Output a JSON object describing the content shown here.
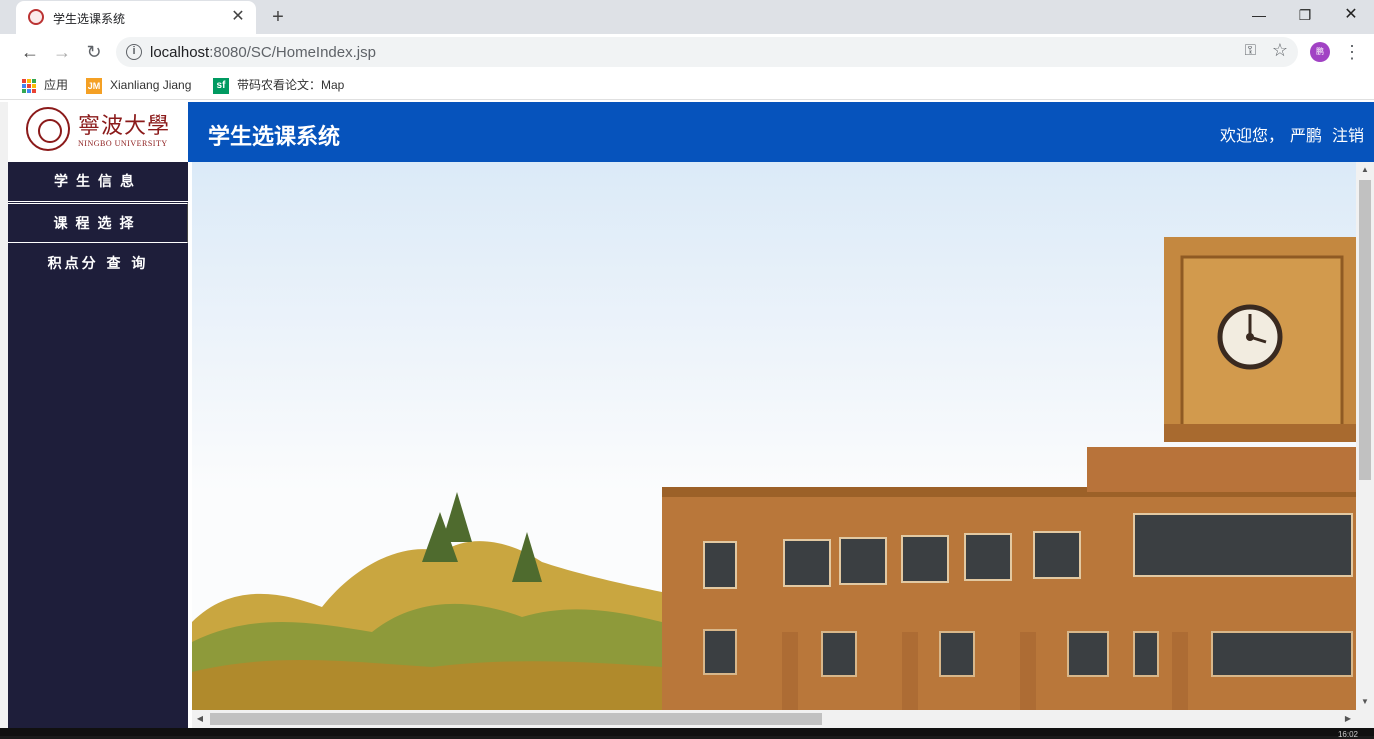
{
  "browser": {
    "tab_title": "学生选课系统",
    "tab_close": "✕",
    "new_tab": "+",
    "window_controls": {
      "minimize": "—",
      "maximize": "❐",
      "close": "✕"
    },
    "url_host": "localhost",
    "url_rest": ":8080/SC/HomeIndex.jsp",
    "profile_initial": "鹏",
    "bookmarks": [
      {
        "label": "应用",
        "icon": "apps-grid-icon"
      },
      {
        "label": "Xianliang Jiang",
        "icon": "jm-icon"
      },
      {
        "label": "带码农看论文：Map",
        "icon": "sf-icon"
      }
    ]
  },
  "header": {
    "school_cn": "寧波大學",
    "school_en": "NINGBO UNIVERSITY",
    "site_title": "学生选课系统",
    "welcome_text": "欢迎您，",
    "user_name": "严鹏",
    "logout_label": "注销"
  },
  "sidebar": {
    "items": [
      {
        "label": "学生信息"
      },
      {
        "label": "课程选择"
      },
      {
        "label": "积点分 查 询"
      }
    ]
  },
  "taskbar": {
    "clock": "16:02"
  },
  "colors": {
    "header_blue": "#0653bc",
    "sidebar_navy": "#1e1e3a",
    "logo_red": "#8b1a1a"
  }
}
